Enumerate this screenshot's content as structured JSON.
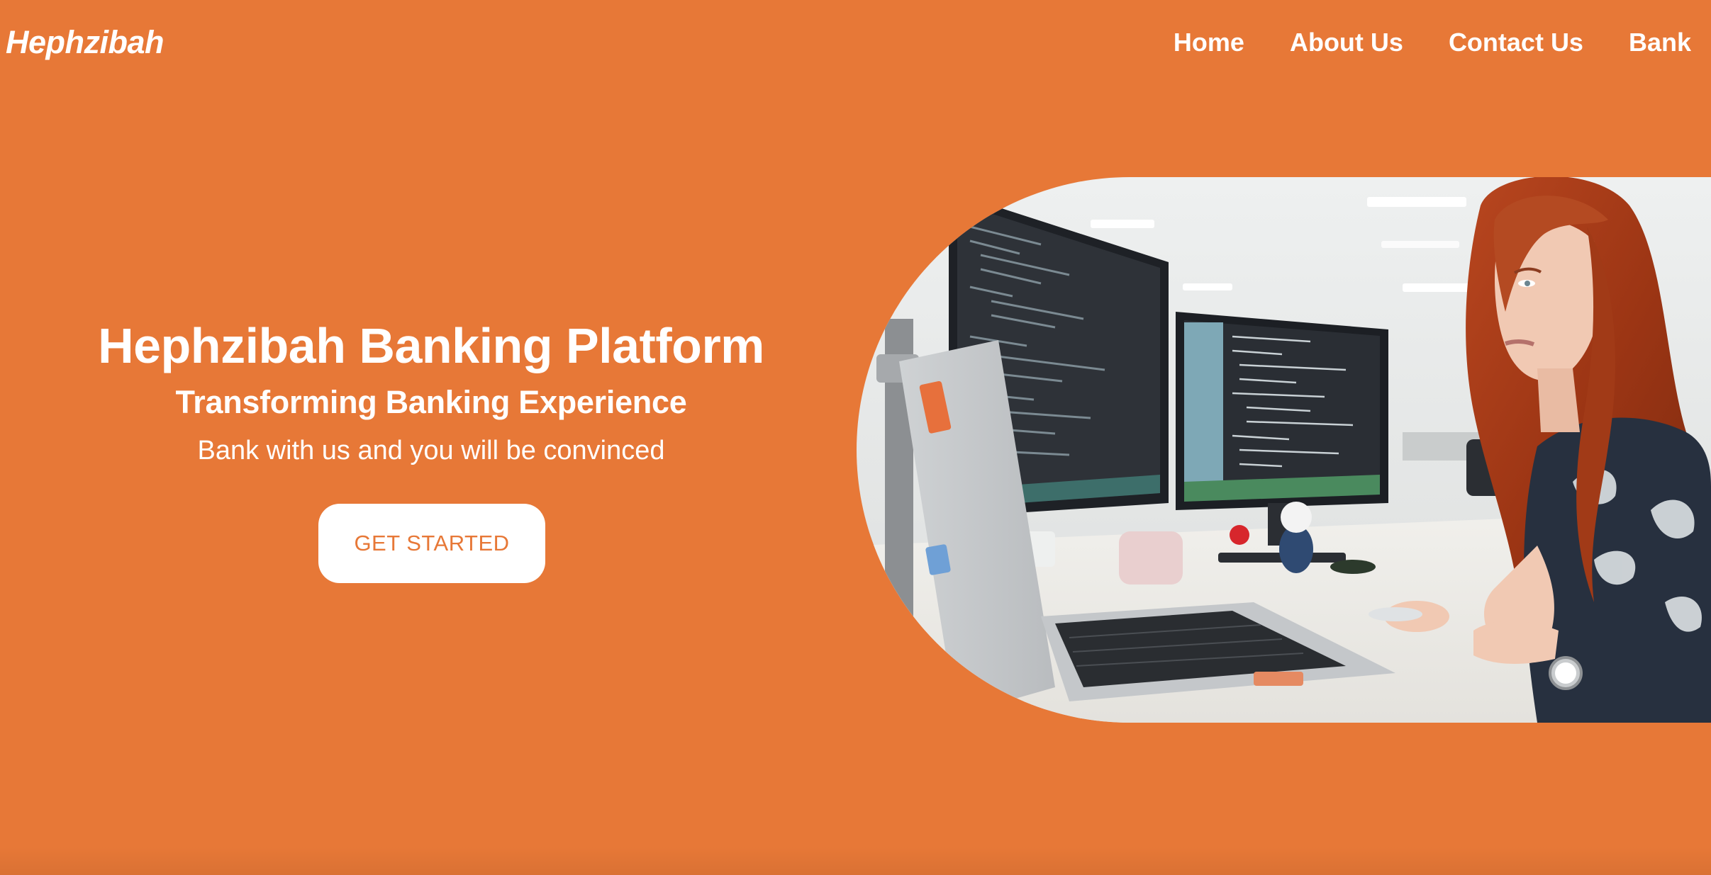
{
  "brand": {
    "name": "Hephzibah"
  },
  "nav": {
    "items": [
      {
        "label": "Home"
      },
      {
        "label": "About Us"
      },
      {
        "label": "Contact Us"
      },
      {
        "label": "Bank"
      }
    ]
  },
  "hero": {
    "title": "Hephzibah Banking Platform",
    "subtitle": "Transforming Banking Experience",
    "tagline": "Bank with us and you will be convinced",
    "cta_label": "GET STARTED",
    "image_icon": "office-photo-woman-at-computer"
  },
  "colors": {
    "background": "#e77837",
    "text": "#ffffff",
    "button_bg": "#ffffff",
    "button_text": "#e77837"
  }
}
